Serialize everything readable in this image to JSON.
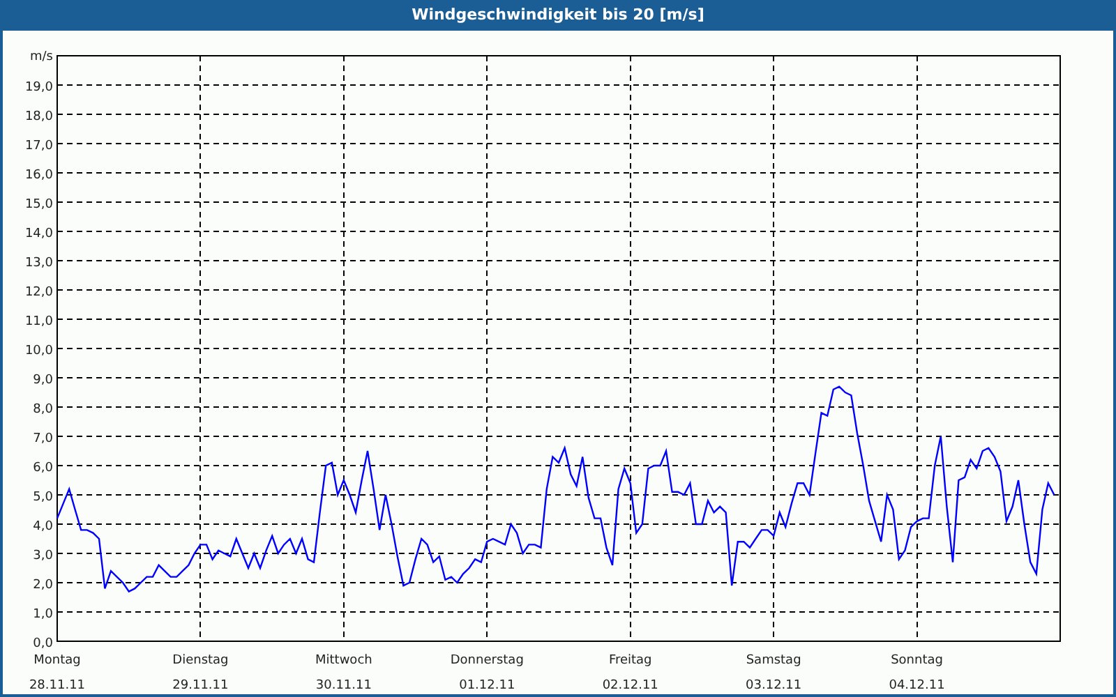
{
  "chart_data": {
    "type": "line",
    "title": "Windgeschwindigkeit bis 20 [m/s]",
    "ylabel": "m/s",
    "ylim": [
      0,
      20
    ],
    "grid": true,
    "yticks": [
      {
        "value": 0,
        "label": "0,0"
      },
      {
        "value": 1,
        "label": "1,0"
      },
      {
        "value": 2,
        "label": "2,0"
      },
      {
        "value": 3,
        "label": "3,0"
      },
      {
        "value": 4,
        "label": "4,0"
      },
      {
        "value": 5,
        "label": "5,0"
      },
      {
        "value": 6,
        "label": "6,0"
      },
      {
        "value": 7,
        "label": "7,0"
      },
      {
        "value": 8,
        "label": "8,0"
      },
      {
        "value": 9,
        "label": "9,0"
      },
      {
        "value": 10,
        "label": "10,0"
      },
      {
        "value": 11,
        "label": "11,0"
      },
      {
        "value": 12,
        "label": "12,0"
      },
      {
        "value": 13,
        "label": "13,0"
      },
      {
        "value": 14,
        "label": "14,0"
      },
      {
        "value": 15,
        "label": "15,0"
      },
      {
        "value": 16,
        "label": "16,0"
      },
      {
        "value": 17,
        "label": "17,0"
      },
      {
        "value": 18,
        "label": "18,0"
      },
      {
        "value": 19,
        "label": "19,0"
      }
    ],
    "categories": [
      "Montag 28.11.11",
      null,
      null,
      null,
      null,
      null,
      null,
      null,
      null,
      null,
      null,
      null,
      null,
      null,
      null,
      null,
      null,
      null,
      null,
      null,
      null,
      null,
      null,
      null,
      "Dienstag 29.11.11",
      null,
      null,
      null,
      null,
      null,
      null,
      null,
      null,
      null,
      null,
      null,
      null,
      null,
      null,
      null,
      null,
      null,
      null,
      null,
      null,
      null,
      null,
      null,
      "Mittwoch 30.11.11",
      null,
      null,
      null,
      null,
      null,
      null,
      null,
      null,
      null,
      null,
      null,
      null,
      null,
      null,
      null,
      null,
      null,
      null,
      null,
      null,
      null,
      null,
      null,
      "Donnerstag 01.12.11",
      null,
      null,
      null,
      null,
      null,
      null,
      null,
      null,
      null,
      null,
      null,
      null,
      null,
      null,
      null,
      null,
      null,
      null,
      null,
      null,
      null,
      null,
      null,
      "Freitag 02.12.11",
      null,
      null,
      null,
      null,
      null,
      null,
      null,
      null,
      null,
      null,
      null,
      null,
      null,
      null,
      null,
      null,
      null,
      null,
      null,
      null,
      null,
      null,
      null,
      "Samstag 03.12.11",
      null,
      null,
      null,
      null,
      null,
      null,
      null,
      null,
      null,
      null,
      null,
      null,
      null,
      null,
      null,
      null,
      null,
      null,
      null,
      null,
      null,
      null,
      null,
      "Sonntag 04.12.11",
      null,
      null,
      null,
      null,
      null,
      null,
      null,
      null,
      null,
      null,
      null,
      null,
      null,
      null,
      null,
      null,
      null,
      null,
      null,
      null,
      null,
      null,
      null
    ],
    "series": [
      {
        "color": "#0000ff",
        "values": [
          4.2,
          4.7,
          5.2,
          4.5,
          3.8,
          3.8,
          3.7,
          3.5,
          1.8,
          2.4,
          2.2,
          2.0,
          1.7,
          1.8,
          2.0,
          2.2,
          2.2,
          2.6,
          2.4,
          2.2,
          2.2,
          2.4,
          2.6,
          3.0,
          3.3,
          3.3,
          2.8,
          3.1,
          3.0,
          2.9,
          3.5,
          3.0,
          2.5,
          3.0,
          2.5,
          3.1,
          3.6,
          3.0,
          3.3,
          3.5,
          3.0,
          3.5,
          2.8,
          2.7,
          4.4,
          6.0,
          6.1,
          5.0,
          5.5,
          5.0,
          4.4,
          5.5,
          6.5,
          5.2,
          3.8,
          5.0,
          4.0,
          2.9,
          1.9,
          2.0,
          2.8,
          3.5,
          3.3,
          2.7,
          2.9,
          2.1,
          2.2,
          2.0,
          2.3,
          2.5,
          2.8,
          2.7,
          3.4,
          3.5,
          3.4,
          3.3,
          4.0,
          3.7,
          3.0,
          3.3,
          3.3,
          3.2,
          5.2,
          6.3,
          6.1,
          6.6,
          5.7,
          5.3,
          6.3,
          4.9,
          4.2,
          4.2,
          3.2,
          2.6,
          5.2,
          5.9,
          5.4,
          3.7,
          4.0,
          5.9,
          6.0,
          6.0,
          6.5,
          5.1,
          5.1,
          5.0,
          5.4,
          4.0,
          4.0,
          4.8,
          4.4,
          4.6,
          4.4,
          1.9,
          3.4,
          3.4,
          3.2,
          3.5,
          3.8,
          3.8,
          3.6,
          4.4,
          3.9,
          4.7,
          5.4,
          5.4,
          5.0,
          6.4,
          7.8,
          7.7,
          8.6,
          8.7,
          8.5,
          8.4,
          7.1,
          6.0,
          4.8,
          4.1,
          3.4,
          5.0,
          4.5,
          2.8,
          3.1,
          3.9,
          4.1,
          4.2,
          4.2,
          6.0,
          7.0,
          4.6,
          2.7,
          5.5,
          5.6,
          6.2,
          5.9,
          6.5,
          6.6,
          6.3,
          5.8,
          4.1,
          4.6,
          5.5,
          4.0,
          2.7,
          2.3,
          4.5,
          5.4,
          5.0
        ]
      }
    ]
  }
}
